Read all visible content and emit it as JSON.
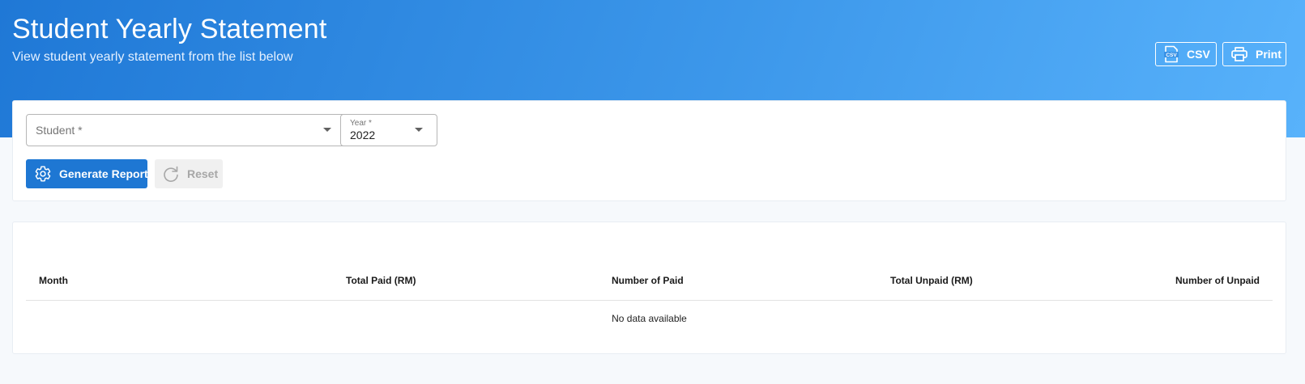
{
  "header": {
    "title": "Student Yearly Statement",
    "subtitle": "View student yearly statement from the list below",
    "csv_label": "CSV",
    "print_label": "Print",
    "csv_icon": "csv-file-icon",
    "print_icon": "printer-icon"
  },
  "filters": {
    "student": {
      "placeholder": "Student *",
      "value": ""
    },
    "year": {
      "label": "Year *",
      "value": "2022"
    }
  },
  "actions": {
    "generate_label": "Generate Report",
    "generate_icon": "gear-icon",
    "reset_label": "Reset",
    "reset_icon": "refresh-icon",
    "reset_enabled": false
  },
  "table": {
    "columns": [
      "Month",
      "Total Paid (RM)",
      "Number of Paid",
      "Total Unpaid (RM)",
      "Number of Unpaid"
    ],
    "rows": [],
    "empty_text": "No data available"
  },
  "colors": {
    "accent": "#1e77d3",
    "banner_start": "#1f78d6",
    "banner_end": "#58b2fb"
  }
}
